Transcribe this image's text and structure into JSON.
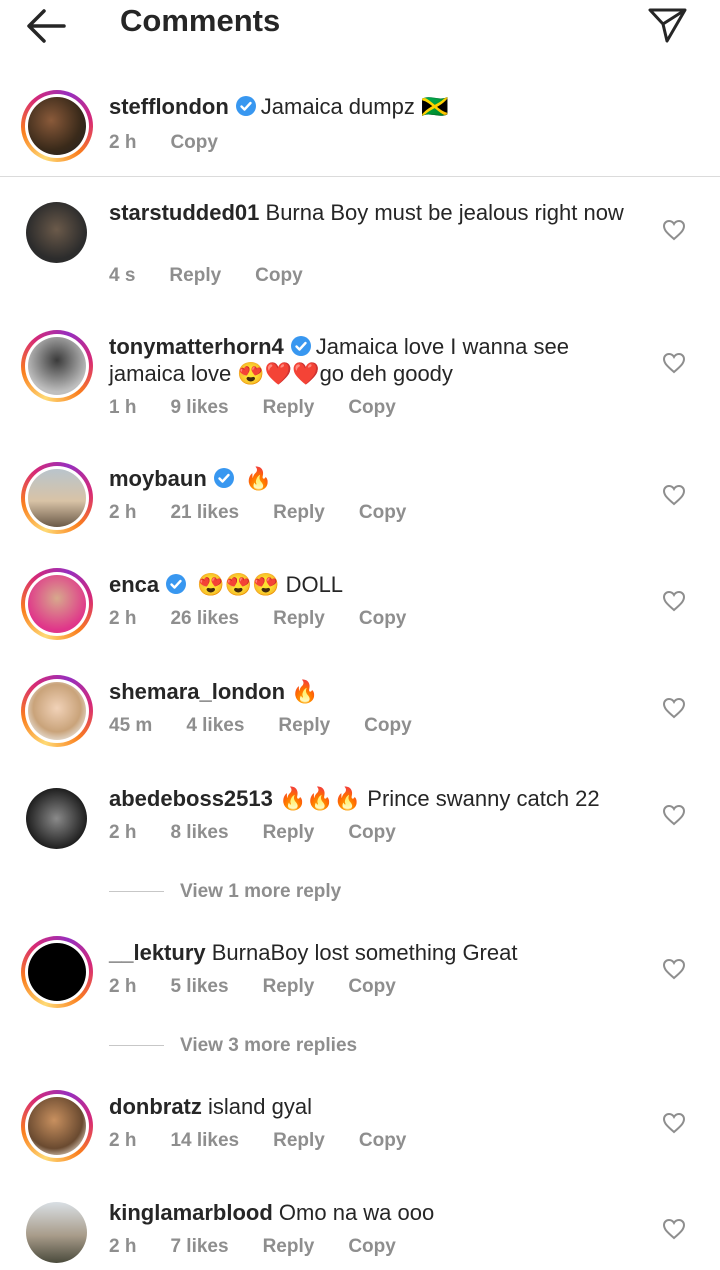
{
  "header": {
    "title": "Comments",
    "back_icon": "arrow-left-icon",
    "share_icon": "paper-plane-icon"
  },
  "caption": {
    "username": "stefflondon",
    "text": "Jamaica dumpz 🇯🇲",
    "time": "2 h",
    "copy_label": "Copy"
  },
  "comments": [
    {
      "username": "starstudded01",
      "text": "Burna Boy must be jealous right now",
      "time": "4 s",
      "likes": "",
      "reply": "Reply",
      "copy": "Copy"
    },
    {
      "username": "tonymatterhorn4",
      "verified": true,
      "text": "Jamaica love I wanna see jamaica love 😍❤️❤️go deh goody",
      "time": "1 h",
      "likes": "9 likes",
      "reply": "Reply",
      "copy": "Copy"
    },
    {
      "username": "moybaun",
      "verified": true,
      "text": "🔥",
      "time": "2 h",
      "likes": "21 likes",
      "reply": "Reply",
      "copy": "Copy"
    },
    {
      "username": "enca",
      "verified": true,
      "text": "😍😍😍 DOLL",
      "time": "2 h",
      "likes": "26 likes",
      "reply": "Reply",
      "copy": "Copy"
    },
    {
      "username": "shemara_london",
      "text": "🔥",
      "time": "45 m",
      "likes": "4 likes",
      "reply": "Reply",
      "copy": "Copy"
    },
    {
      "username": "abedeboss2513",
      "text": "🔥🔥🔥 Prince swanny catch 22",
      "time": "2 h",
      "likes": "8 likes",
      "reply": "Reply",
      "copy": "Copy",
      "view_more": "View 1 more reply"
    },
    {
      "username": "__lektury",
      "text": "BurnaBoy  lost something Great",
      "time": "2 h",
      "likes": "5 likes",
      "reply": "Reply",
      "copy": "Copy",
      "view_more": "View 3 more replies"
    },
    {
      "username": "donbratz",
      "text": "island gyal",
      "time": "2 h",
      "likes": "14 likes",
      "reply": "Reply",
      "copy": "Copy"
    },
    {
      "username": "kinglamarblood",
      "text": "Omo na wa ooo",
      "time": "2 h",
      "likes": "7 likes",
      "reply": "Reply",
      "copy": "Copy"
    }
  ],
  "colors": {
    "text": "#262626",
    "secondary": "#8e8e8e",
    "verified": "#3897f0",
    "divider": "#dbdbdb"
  }
}
